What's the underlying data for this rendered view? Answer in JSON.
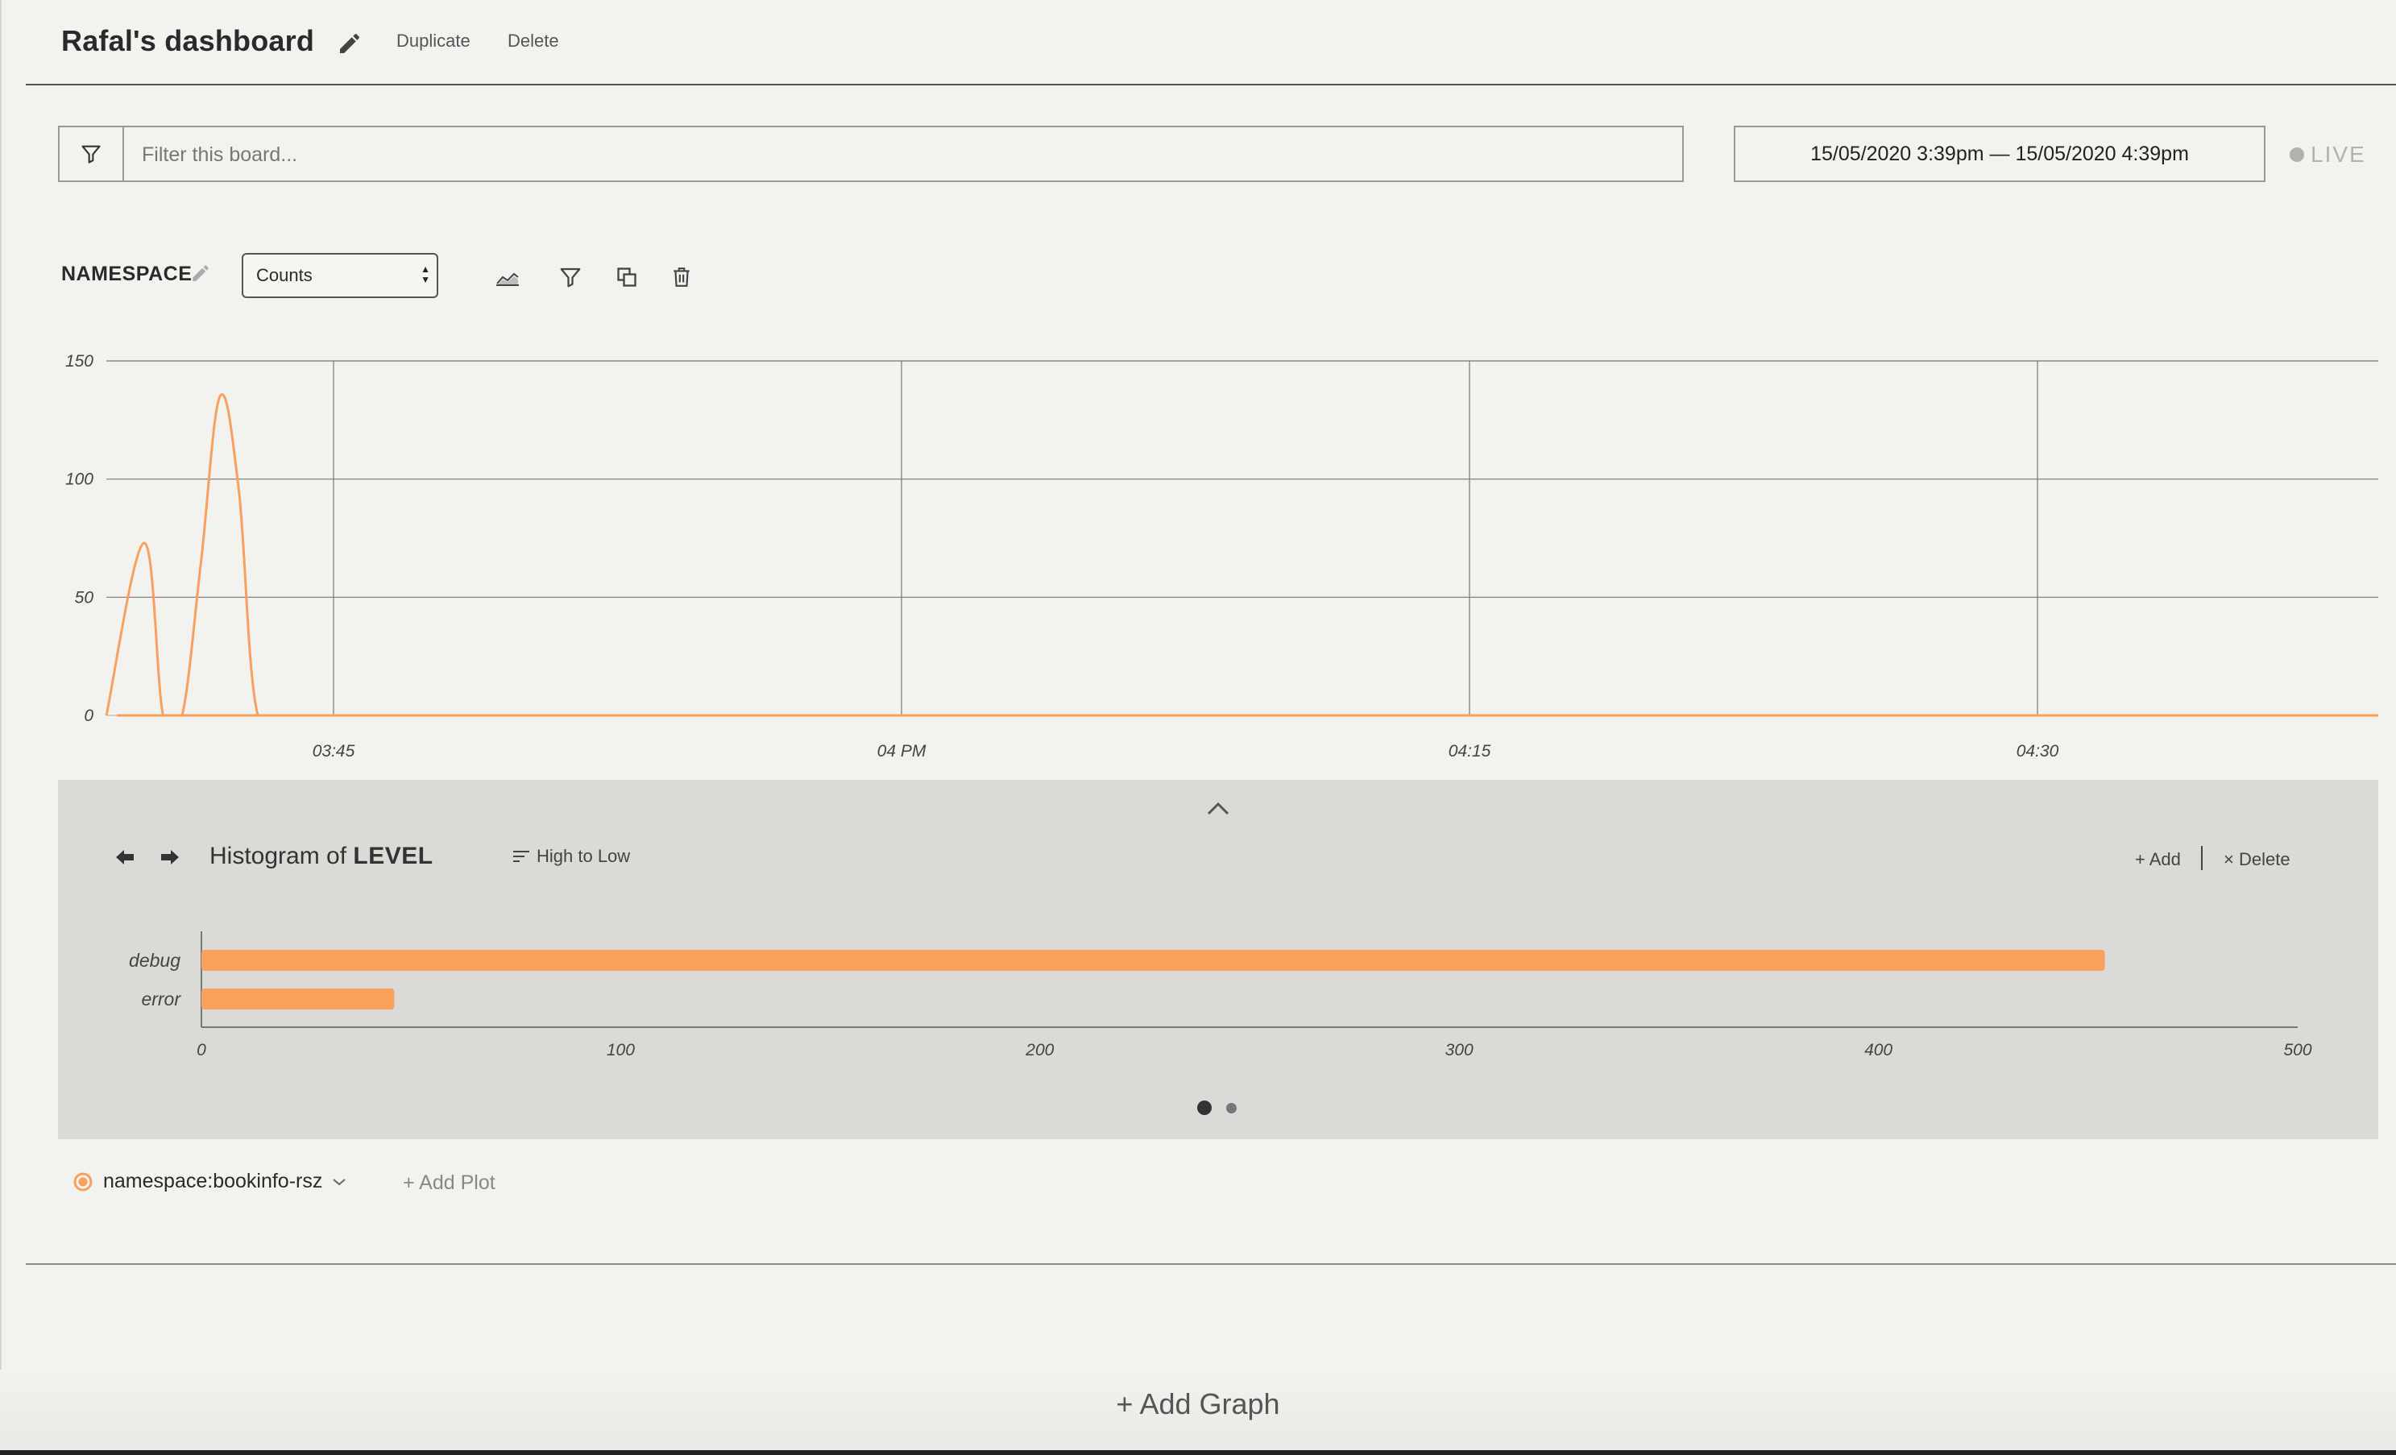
{
  "header": {
    "title": "Rafal's dashboard",
    "duplicate_label": "Duplicate",
    "delete_label": "Delete"
  },
  "filter": {
    "placeholder": "Filter this board...",
    "value": ""
  },
  "time_range": "15/05/2020 3:39pm — 15/05/2020 4:39pm",
  "live_label": "LIVE",
  "graph": {
    "name": "NAMESPACE",
    "select_value": "Counts",
    "accent_color": "#f9a05c"
  },
  "histogram": {
    "title_prefix": "Histogram of",
    "title_field": "LEVEL",
    "sort_label": "High to Low",
    "add_label": "+ Add",
    "delete_label": "× Delete"
  },
  "legend": {
    "label": "namespace:bookinfo-rsz",
    "add_plot_label": "+ Add Plot"
  },
  "add_graph_label": "+ Add Graph",
  "chart_data": [
    {
      "type": "line",
      "title": "",
      "xlabel": "",
      "ylabel": "",
      "ylim": [
        0,
        150
      ],
      "y_ticks": [
        "0",
        "50",
        "100",
        "150"
      ],
      "x_ticks": [
        "03:45",
        "04 PM",
        "04:15",
        "04:30"
      ],
      "grid": true,
      "series": [
        {
          "x": [
            "15:39",
            "15:40",
            "15:40:30",
            "15:41",
            "15:41:30",
            "15:42",
            "15:42:30",
            "15:43",
            "15:44",
            "16:39"
          ],
          "values": [
            0,
            73,
            0,
            0,
            65,
            135,
            95,
            0,
            0,
            0
          ]
        }
      ]
    },
    {
      "type": "bar",
      "orientation": "horizontal",
      "categories": [
        "debug",
        "error"
      ],
      "values": [
        454,
        46
      ],
      "xlim": [
        0,
        500
      ],
      "x_ticks": [
        "0",
        "100",
        "200",
        "300",
        "400",
        "500"
      ]
    }
  ]
}
